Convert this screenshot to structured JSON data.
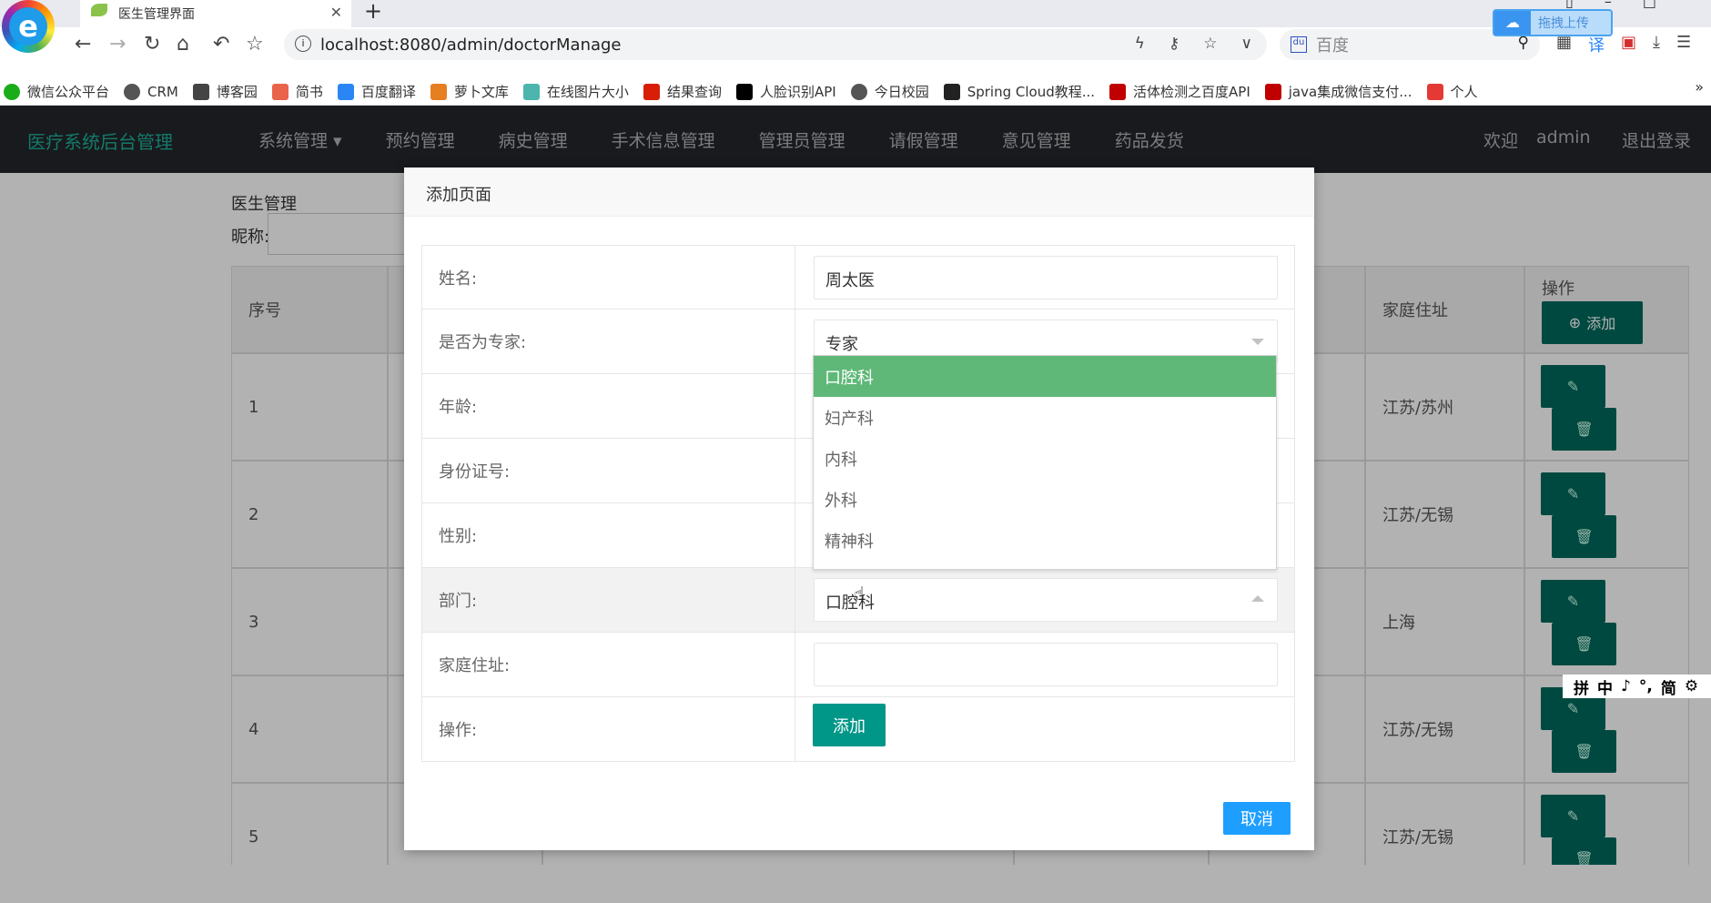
{
  "browser": {
    "tab_title": "医生管理界面",
    "url": "localhost:8080/admin/doctorManage",
    "search_engine": "百度",
    "upload_widget": "拖拽上传",
    "bookmarks": [
      {
        "label": "微信公众平台",
        "color": "#1aad19"
      },
      {
        "label": "CRM",
        "color": "#555555"
      },
      {
        "label": "博客园",
        "color": "#444444"
      },
      {
        "label": "简书",
        "color": "#e9644a"
      },
      {
        "label": "百度翻译",
        "color": "#2b86f5"
      },
      {
        "label": "萝卜文库",
        "color": "#e67e22"
      },
      {
        "label": "在线图片大小",
        "color": "#4db6ac"
      },
      {
        "label": "结果查询",
        "color": "#d81e06"
      },
      {
        "label": "人脸识别API",
        "color": "#000000"
      },
      {
        "label": "今日校园",
        "color": "#555555"
      },
      {
        "label": "Spring Cloud教程...",
        "color": "#222222"
      },
      {
        "label": "活体检测之百度API",
        "color": "#c00000"
      },
      {
        "label": "java集成微信支付...",
        "color": "#c00000"
      },
      {
        "label": "个人",
        "color": "#e53935"
      }
    ]
  },
  "navbar": {
    "brand": "医疗系统后台管理",
    "menu": [
      "系统管理",
      "预约管理",
      "病史管理",
      "手术信息管理",
      "管理员管理",
      "请假管理",
      "意见管理",
      "药品发货"
    ],
    "welcome": "欢迎",
    "user": "admin",
    "logout": "退出登录"
  },
  "page": {
    "title": "医生管理",
    "nick_label": "昵称:",
    "table": {
      "headers": {
        "index": "序号",
        "address": "家庭住址",
        "actions": "操作"
      },
      "add_label": "添加",
      "rows": [
        {
          "index": "1",
          "address": "江苏/苏州"
        },
        {
          "index": "2",
          "address": "江苏/无锡"
        },
        {
          "index": "3",
          "address": "上海"
        },
        {
          "index": "4",
          "address": "江苏/无锡"
        },
        {
          "index": "5",
          "address": "江苏/无锡"
        }
      ]
    }
  },
  "modal": {
    "title": "添加页面",
    "fields": {
      "name": {
        "label": "姓名:",
        "value": "周太医"
      },
      "expert": {
        "label": "是否为专家:",
        "value": "专家"
      },
      "age": {
        "label": "年龄:"
      },
      "idcard": {
        "label": "身份证号:"
      },
      "gender": {
        "label": "性别:"
      },
      "dept": {
        "label": "部门:",
        "value": "口腔科"
      },
      "address": {
        "label": "家庭住址:",
        "value": ""
      },
      "action": {
        "label": "操作:"
      }
    },
    "dept_options": [
      "口腔科",
      "妇产科",
      "内科",
      "外科",
      "精神科"
    ],
    "add_button": "添加",
    "cancel_button": "取消"
  },
  "ime": [
    "拼",
    "中",
    "♪",
    "°,",
    "简",
    "⚙"
  ],
  "colors": {
    "primary": "#009688",
    "selected": "#5fb878",
    "cancel": "#1e9fff",
    "navbar": "#191a1d"
  }
}
